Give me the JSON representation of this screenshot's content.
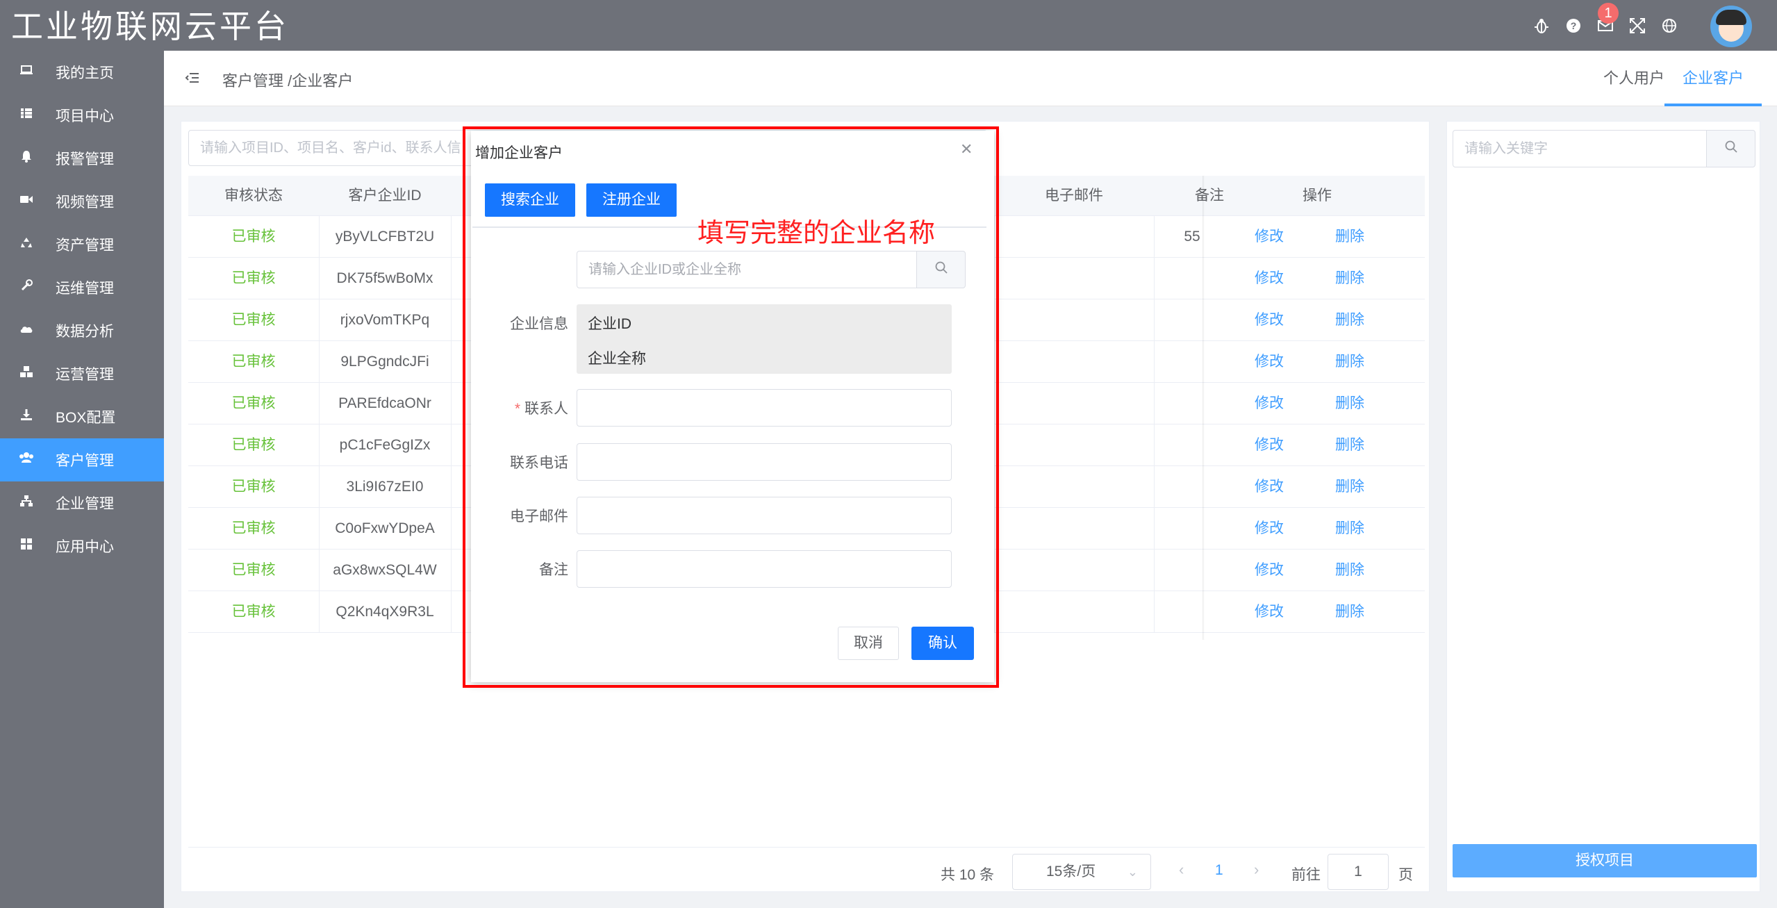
{
  "app": {
    "title": "工业物联网云平台",
    "notification_count": "1"
  },
  "topbar_icons": [
    "bug-icon",
    "help-icon",
    "mail-icon",
    "fullscreen-icon",
    "globe-icon"
  ],
  "sidebar": {
    "items": [
      {
        "label": "我的主页",
        "icon": "laptop-icon"
      },
      {
        "label": "项目中心",
        "icon": "list-icon"
      },
      {
        "label": "报警管理",
        "icon": "bell-icon"
      },
      {
        "label": "视频管理",
        "icon": "video-icon"
      },
      {
        "label": "资产管理",
        "icon": "recycle-icon"
      },
      {
        "label": "运维管理",
        "icon": "wrench-icon"
      },
      {
        "label": "数据分析",
        "icon": "cloud-chart-icon"
      },
      {
        "label": "运营管理",
        "icon": "cubes-icon"
      },
      {
        "label": "BOX配置",
        "icon": "download-icon"
      },
      {
        "label": "客户管理",
        "icon": "users-icon",
        "active": true
      },
      {
        "label": "企业管理",
        "icon": "sitemap-icon"
      },
      {
        "label": "应用中心",
        "icon": "grid-icon"
      }
    ]
  },
  "header": {
    "breadcrumb": "客户管理 /企业客户",
    "tabs": [
      {
        "label": "个人用户",
        "active": false
      },
      {
        "label": "企业客户",
        "active": true
      }
    ]
  },
  "main": {
    "search_placeholder": "请输入项目ID、项目名、客户id、联系人信",
    "columns": {
      "status": "审核状态",
      "company_id": "客户企业ID",
      "email": "电子邮件",
      "note": "备注",
      "ops": "操作"
    },
    "rows": [
      {
        "status": "已审核",
        "company_id": "yByVLCFBT2U",
        "note": "55"
      },
      {
        "status": "已审核",
        "company_id": "DK75f5wBoMx",
        "note": ""
      },
      {
        "status": "已审核",
        "company_id": "rjxoVomTKPq",
        "note": ""
      },
      {
        "status": "已审核",
        "company_id": "9LPGgndcJFi",
        "note": ""
      },
      {
        "status": "已审核",
        "company_id": "PAREfdcaONr",
        "note": ""
      },
      {
        "status": "已审核",
        "company_id": "pC1cFeGgIZx",
        "note": ""
      },
      {
        "status": "已审核",
        "company_id": "3Li9I67zEI0",
        "note": ""
      },
      {
        "status": "已审核",
        "company_id": "C0oFxwYDpeA",
        "note": ""
      },
      {
        "status": "已审核",
        "company_id": "aGx8wxSQL4W",
        "note": ""
      },
      {
        "status": "已审核",
        "company_id": "Q2Kn4qX9R3L",
        "note": ""
      }
    ],
    "edit_label": "修改",
    "delete_label": "删除"
  },
  "pagination": {
    "total": "共 10 条",
    "page_size": "15条/页",
    "current_page": "1",
    "goto_label": "前往",
    "goto_value": "1",
    "page_suffix": "页"
  },
  "right_panel": {
    "search_placeholder": "请输入关键字",
    "authorize_button": "授权项目"
  },
  "dialog": {
    "title": "增加企业客户",
    "tab_search": "搜索企业",
    "tab_register": "注册企业",
    "search_placeholder": "请输入企业ID或企业全称",
    "info_label": "企业信息",
    "info_id": "企业ID",
    "info_name": "企业全称",
    "required_mark": "*",
    "contact_label": "联系人",
    "phone_label": "联系电话",
    "email_label": "电子邮件",
    "note_label": "备注",
    "cancel": "取消",
    "confirm": "确认"
  },
  "annotation": {
    "text": "填写完整的企业名称",
    "color": "#ff0000"
  },
  "colors": {
    "sidebar_bg": "#6e7179",
    "accent": "#409eff",
    "status_green": "#67c23a"
  }
}
